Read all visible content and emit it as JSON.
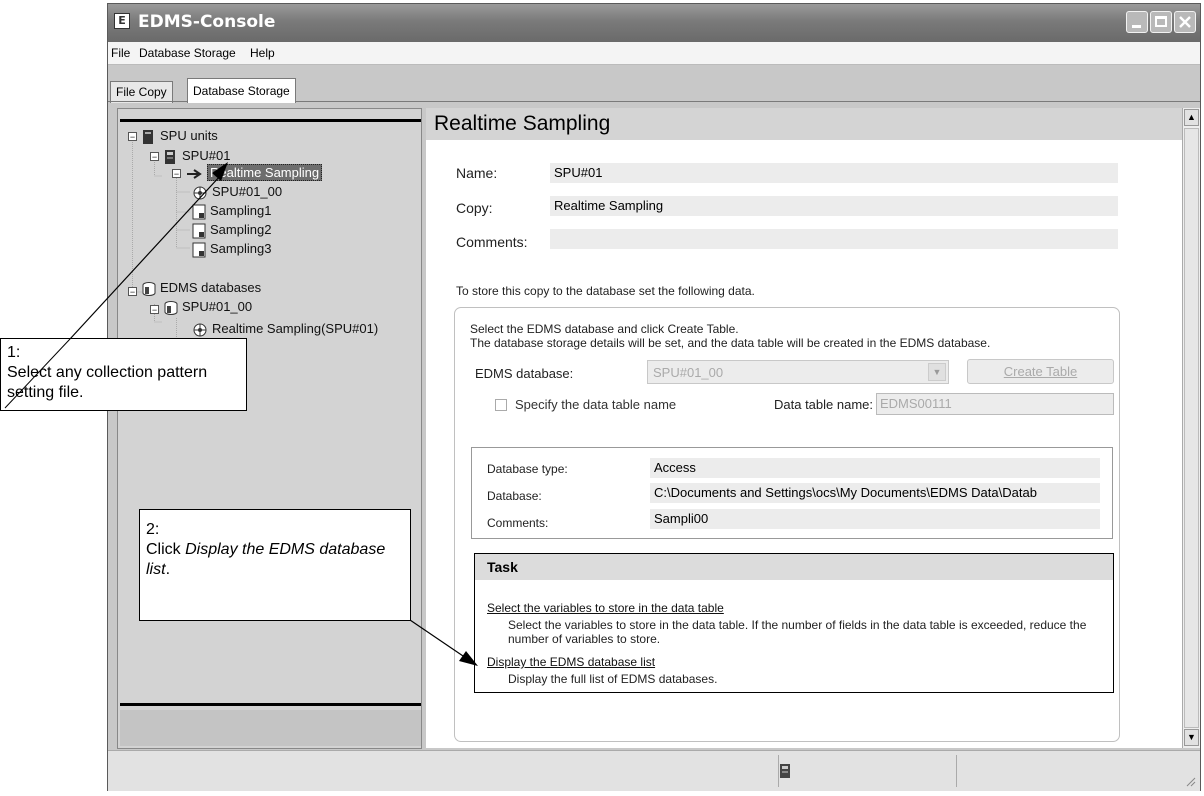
{
  "window": {
    "title": "EDMS-Console",
    "icon_letter": "E"
  },
  "menu": [
    "File",
    "Database Storage",
    "Help"
  ],
  "tabs": [
    "File Copy",
    "Database Storage"
  ],
  "tree": {
    "root": "SPU units",
    "unit": "SPU#01",
    "sampling": "Realtime Sampling",
    "sampling_child": "SPU#01_00",
    "files": [
      "Sampling1",
      "Sampling2",
      "Sampling3"
    ],
    "db_root": "EDMS databases",
    "db": "SPU#01_00",
    "db_child": "Realtime Sampling(SPU#01)"
  },
  "panel": {
    "header": "Realtime Sampling",
    "name_label": "Name:",
    "name_value": "SPU#01",
    "copy_label": "Copy:",
    "copy_value": "Realtime Sampling",
    "comments_label": "Comments:",
    "comments_value": "",
    "store_instruction": "To store this copy to the database set the following data.",
    "group_text_1": "Select the EDMS database and click Create Table.",
    "group_text_2": "The database storage details will be set, and the data table will be created in the EDMS database.",
    "edms_db_label": "EDMS database:",
    "edms_db_value": "SPU#01_00",
    "create_table": "Create Table",
    "specify_name": "Specify the data table name",
    "data_table_label": "Data table name:",
    "data_table_value": "EDMS00111",
    "db_type_label": "Database type:",
    "db_type_value": "Access",
    "database_label": "Database:",
    "database_value": "C:\\Documents and Settings\\ocs\\My Documents\\EDMS Data\\Datab",
    "info_comments_label": "Comments:",
    "info_comments_value": "Sampli00",
    "task_title": "Task",
    "task1_link": "Select the variables to store in the data table",
    "task1_desc": "Select the variables to store in the data table. If the number of fields in the data table is exceeded, reduce the number of variables to store.",
    "task2_link": "Display the EDMS database list",
    "task2_desc": "Display the full list of EDMS databases."
  },
  "callouts": {
    "c1_num": "1:",
    "c1_text": "Select any collection pattern setting file.",
    "c2_num": "2:",
    "c2_pre": "Click ",
    "c2_em": "Display the EDMS database list",
    "c2_post": "."
  }
}
